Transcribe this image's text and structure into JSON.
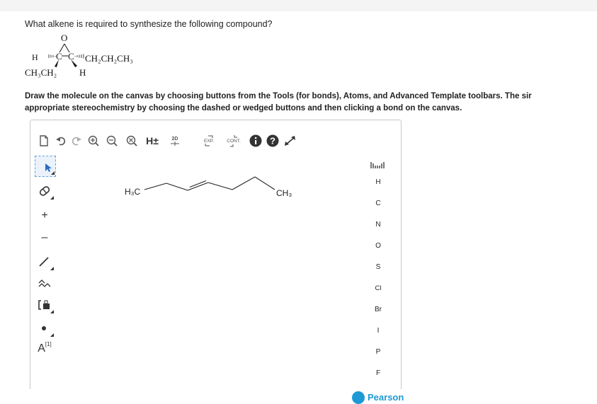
{
  "question": {
    "text": "What alkene is required to synthesize the following compound?"
  },
  "molecule": {
    "oxygen": "O",
    "left_c": "C",
    "right_c": "C",
    "left_h": "H",
    "right_sub": "CH₂CH₂CH₃",
    "left_sub": "CH₃CH₂",
    "bottom_h": "H"
  },
  "instructions": {
    "line1": "Draw the molecule on the canvas by choosing buttons from the Tools (for bonds), Atoms, and Advanced Template toolbars. The sir",
    "line2": "appropriate stereochemistry by choosing the dashed or wedged buttons and then clicking a bond on the canvas."
  },
  "toolbar": {
    "h_toggle": "H±",
    "clean2d": "2D",
    "expand": "EXP.",
    "contract": "CONT."
  },
  "left_toolbar": {
    "charge_plus": "+",
    "charge_minus": "–",
    "atom_map": "A",
    "atom_map_sup": "[1]"
  },
  "canvas": {
    "left_label": "H₃C",
    "right_label": "CH₃"
  },
  "atoms": [
    "H",
    "C",
    "N",
    "O",
    "S",
    "Cl",
    "Br",
    "I",
    "P",
    "F"
  ],
  "brand": {
    "logo_text": "Pearson"
  }
}
